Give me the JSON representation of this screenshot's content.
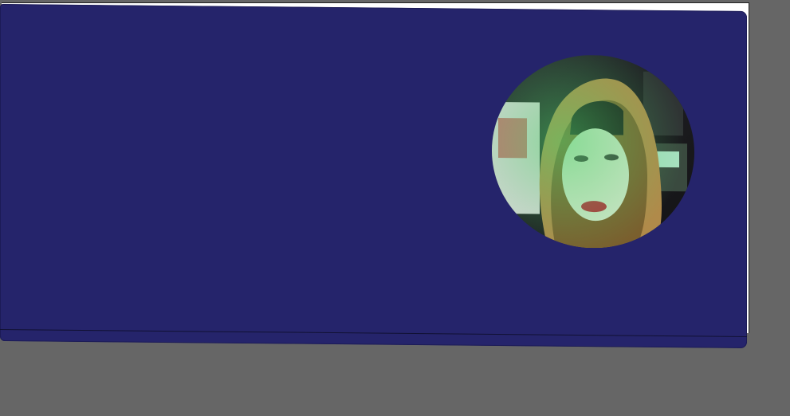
{
  "canvas": {
    "background_color": "#666666"
  },
  "card": {
    "background_color": "#25246b"
  },
  "profile": {
    "avatar_icon": "profile-photo",
    "avatar_colors": {
      "backdrop": "#222226",
      "scarf": "#b08a4a",
      "scarf_shadow": "#7a5f2e",
      "skin": "#cfe4c8",
      "cap": "#1a1a1a",
      "lips": "#b0303a",
      "glow": "#4fd36b"
    }
  }
}
